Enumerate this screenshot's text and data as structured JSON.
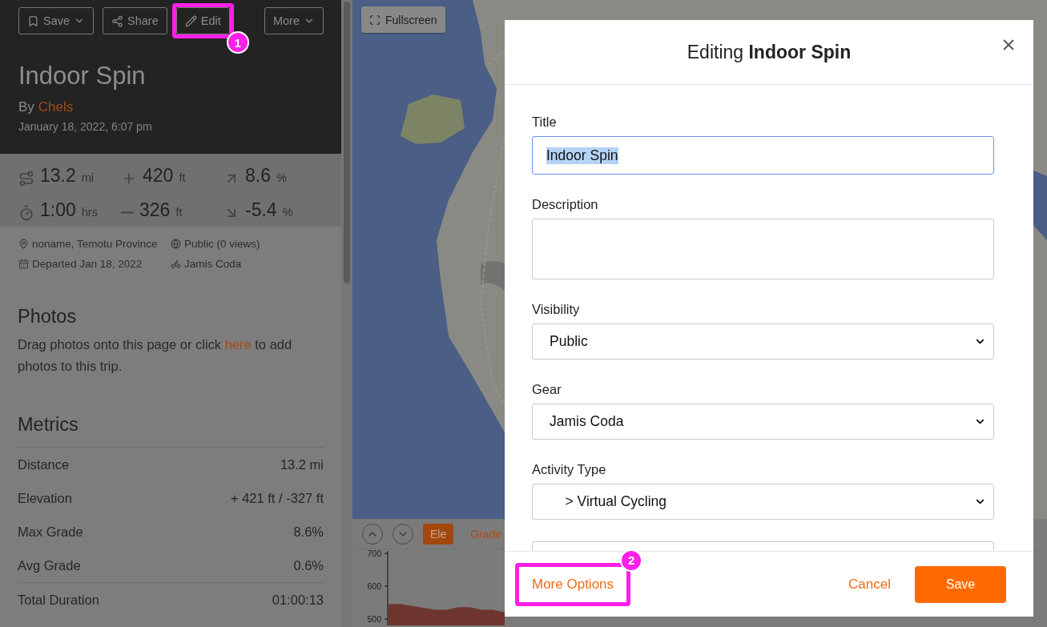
{
  "toolbar": {
    "buttons": [
      {
        "kind": "save",
        "label": "Save",
        "dropdown": true
      },
      {
        "kind": "share",
        "label": "Share",
        "dropdown": false
      },
      {
        "kind": "edit",
        "label": "Edit",
        "dropdown": false,
        "callout": "1"
      },
      {
        "kind": "more",
        "label": "More",
        "dropdown": true
      }
    ]
  },
  "trip": {
    "title": "Indoor Spin",
    "by": "By",
    "author": "Chels",
    "date": "January 18, 2022, 6:07 pm"
  },
  "stats": [
    {
      "kind": "distance",
      "value": "13.2",
      "unit": "mi"
    },
    {
      "kind": "gain",
      "value": "420",
      "unit": "ft"
    },
    {
      "kind": "max_grade",
      "value": "8.6",
      "unit": "%"
    },
    {
      "kind": "duration",
      "value": "1:00",
      "unit": "hrs"
    },
    {
      "kind": "loss",
      "value": "326",
      "unit": "ft"
    },
    {
      "kind": "min_grade",
      "value": "-5.4",
      "unit": "%"
    }
  ],
  "details": [
    {
      "kind": "location",
      "text": "noname, Temotu Province"
    },
    {
      "kind": "visibility",
      "text": "Public (0 views)"
    },
    {
      "kind": "date",
      "text": "Departed Jan 18, 2022"
    },
    {
      "kind": "gear",
      "text": "Jamis Coda"
    }
  ],
  "photos": {
    "heading": "Photos",
    "before": "Drag photos onto this page or click",
    "link": "here",
    "after": "to add photos to this trip."
  },
  "metrics": {
    "heading": "Metrics",
    "rows": [
      {
        "label": "Distance",
        "value": "13.2 mi"
      },
      {
        "label": "Elevation",
        "value": "+ 421 ft / -327 ft"
      },
      {
        "label": "Max Grade",
        "value": "8.6%"
      },
      {
        "label": "Avg Grade",
        "value": "0.6%"
      }
    ],
    "totals": [
      {
        "label": "Total Duration",
        "value": "01:00:13"
      }
    ]
  },
  "map": {
    "fullscreen": "Fullscreen"
  },
  "elevation": {
    "tabs": [
      {
        "label": "Ele",
        "selected": true
      },
      {
        "label": "Grade",
        "selected": false
      }
    ],
    "chart_data": {
      "type": "area",
      "ylim": [
        480,
        710
      ],
      "yticks": [
        500,
        600,
        700
      ],
      "series": [
        {
          "color": "#6e352e",
          "values": [
            545,
            546,
            540,
            534,
            528,
            528,
            536,
            536,
            528,
            528,
            520
          ]
        }
      ]
    }
  },
  "modal": {
    "title_prefix": "Editing",
    "title_name": "Indoor Spin",
    "fields": [
      {
        "kind": "text",
        "label": "Title",
        "value": "Indoor Spin",
        "text_selected": true
      },
      {
        "kind": "textarea",
        "label": "Description"
      },
      {
        "kind": "select",
        "label": "Visibility",
        "value": "Public"
      },
      {
        "kind": "select",
        "label": "Gear",
        "value": "Jamis Coda"
      },
      {
        "kind": "select",
        "label": "Activity Type",
        "value": "    > Virtual Cycling"
      },
      {
        "kind": "text"
      }
    ],
    "more_options": "More Options",
    "more_options_callout": "2",
    "cancel": "Cancel",
    "save": "Save"
  }
}
